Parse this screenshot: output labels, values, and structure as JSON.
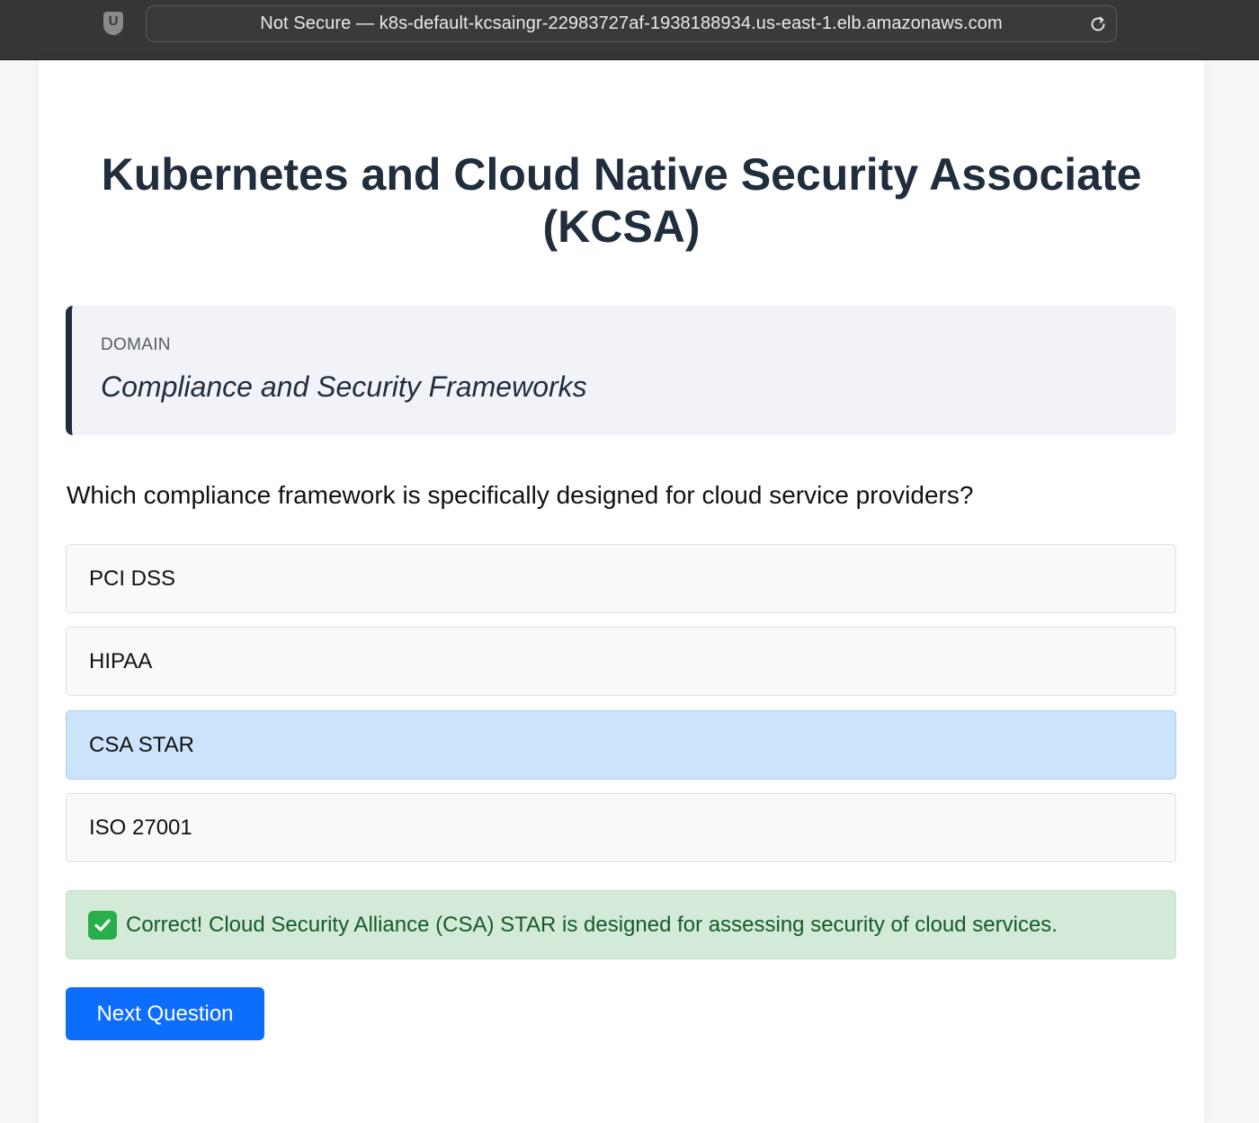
{
  "browser": {
    "extension_icon_letter": "U",
    "address": "Not Secure — k8s-default-kcsaingr-22983727af-1938188934.us-east-1.elb.amazonaws.com"
  },
  "page": {
    "title": "Kubernetes and Cloud Native Security Associate (KCSA)"
  },
  "domain": {
    "label": "DOMAIN",
    "value": "Compliance and Security Frameworks"
  },
  "question": {
    "text": "Which compliance framework is specifically designed for cloud service providers?",
    "options": [
      {
        "label": "PCI DSS"
      },
      {
        "label": "HIPAA"
      },
      {
        "label": "CSA STAR"
      },
      {
        "label": "ISO 27001"
      }
    ],
    "selected_option": "CSA STAR"
  },
  "feedback": {
    "text": "Correct! Cloud Security Alliance (CSA) STAR is designed for assessing security of cloud services.",
    "icon": "check-mark-icon",
    "color": "#165b28"
  },
  "actions": {
    "next_label": "Next Question"
  },
  "colors": {
    "primary": "#0d6efd",
    "selected_bg": "#cce4fb",
    "success_bg": "#d2ead7",
    "title": "#1f2d3d"
  }
}
